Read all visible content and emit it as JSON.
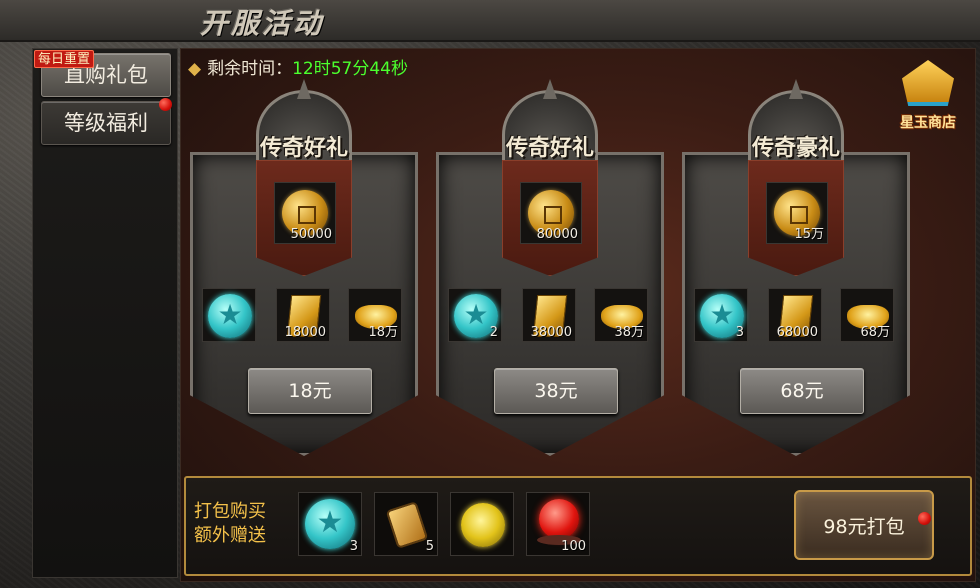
{
  "header": {
    "title": "开服活动"
  },
  "sidebar": {
    "daily_badge": "每日重置",
    "items": [
      {
        "label": "直购礼包",
        "active": true
      },
      {
        "label": "等级福利",
        "active": false,
        "has_notification": true
      }
    ]
  },
  "countdown": {
    "label": "剩余时间：",
    "value": "12时57分44秒"
  },
  "shop": {
    "label": "星玉商店"
  },
  "cards": [
    {
      "title": "传奇好礼",
      "main_item": {
        "icon": "gold-coin-icon",
        "qty": "50000"
      },
      "items": [
        {
          "icon": "blue-gem-icon",
          "qty": ""
        },
        {
          "icon": "gold-ticket-icon",
          "qty": "18000"
        },
        {
          "icon": "gold-ingot-icon",
          "qty": "18万"
        }
      ],
      "price": "18元"
    },
    {
      "title": "传奇好礼",
      "main_item": {
        "icon": "gold-coin-icon",
        "qty": "80000"
      },
      "items": [
        {
          "icon": "blue-gem-icon",
          "qty": "2"
        },
        {
          "icon": "gold-ticket-icon",
          "qty": "38000"
        },
        {
          "icon": "gold-ingot-icon",
          "qty": "38万"
        }
      ],
      "price": "38元"
    },
    {
      "title": "传奇豪礼",
      "main_item": {
        "icon": "gold-coin-icon",
        "qty": "15万"
      },
      "items": [
        {
          "icon": "blue-gem-icon",
          "qty": "3"
        },
        {
          "icon": "gold-ticket-icon",
          "qty": "68000"
        },
        {
          "icon": "gold-ingot-icon",
          "qty": "68万"
        }
      ],
      "price": "68元"
    }
  ],
  "bundle": {
    "label_line1": "打包购买",
    "label_line2": "额外赠送",
    "items": [
      {
        "icon": "blue-gem-icon",
        "qty": "3"
      },
      {
        "icon": "bronze-token-icon",
        "qty": "5"
      },
      {
        "icon": "yellow-orb-icon",
        "qty": ""
      },
      {
        "icon": "red-orb-icon",
        "qty": "100"
      }
    ],
    "button_label": "98元打包"
  },
  "colors": {
    "countdown_value": "#4bff2e",
    "bundle_label": "#f4c14a",
    "notification_dot": "#d4100a",
    "border_gold": "#b38a3c"
  }
}
